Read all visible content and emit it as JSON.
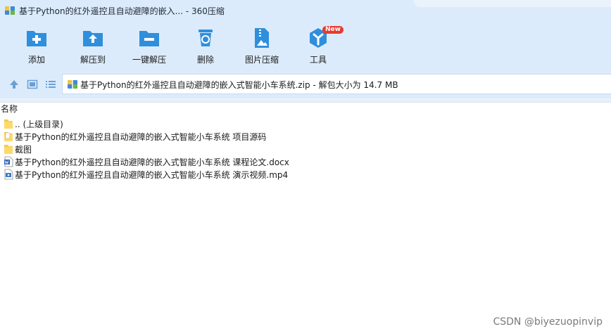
{
  "window": {
    "title": "基于Python的红外遥控且自动避障的嵌入... - 360压缩"
  },
  "toolbar": {
    "items": [
      {
        "label": "添加",
        "icon": "folder-plus-icon"
      },
      {
        "label": "解压到",
        "icon": "folder-extract-icon"
      },
      {
        "label": "一键解压",
        "icon": "folder-minus-icon"
      },
      {
        "label": "删除",
        "icon": "trash-recycle-icon"
      },
      {
        "label": "图片压缩",
        "icon": "image-zip-icon"
      },
      {
        "label": "工具",
        "icon": "tools-cube-icon",
        "badge": "New"
      }
    ]
  },
  "addressbar": {
    "path": "基于Python的红外遥控且自动避障的嵌入式智能小车系统.zip - 解包大小为 14.7 MB"
  },
  "list": {
    "header": "名称",
    "items": [
      {
        "name": ".. (上级目录)",
        "icon": "folder-icon"
      },
      {
        "name": "基于Python的红外遥控且自动避障的嵌入式智能小车系统 项目源码",
        "icon": "folder-doc-icon"
      },
      {
        "name": "截图",
        "icon": "folder-icon"
      },
      {
        "name": "基于Python的红外遥控且自动避障的嵌入式智能小车系统 课程论文.docx",
        "icon": "word-doc-icon"
      },
      {
        "name": "基于Python的红外遥控且自动避障的嵌入式智能小车系统 演示视频.mp4",
        "icon": "video-file-icon"
      }
    ]
  },
  "watermark": "CSDN @biyezuopinvip",
  "colors": {
    "accent": "#2f8fdc",
    "chrome": "#dcebfb",
    "badge": "#e83a30",
    "folder": "#f5c94c"
  }
}
